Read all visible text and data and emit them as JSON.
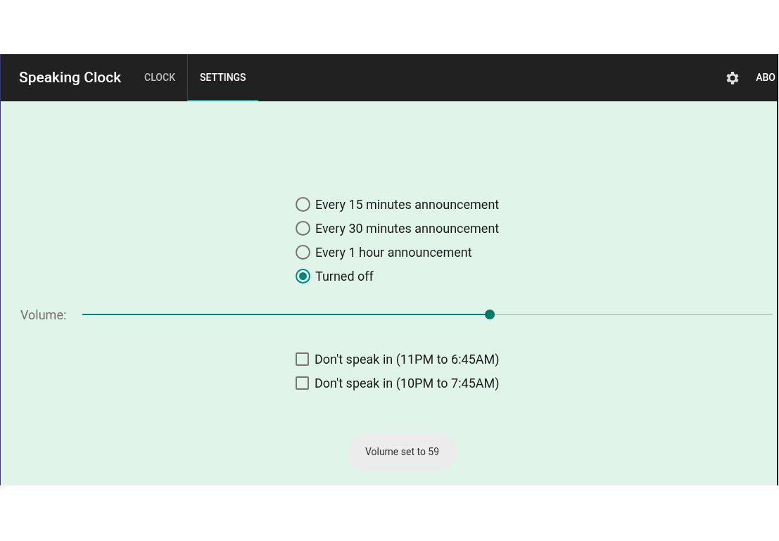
{
  "app_bar": {
    "title": "Speaking Clock",
    "tabs": [
      {
        "label": "CLOCK",
        "selected": false
      },
      {
        "label": "SETTINGS",
        "selected": true
      }
    ],
    "about_label": "ABO"
  },
  "announcements": [
    {
      "label": "Every 15 minutes announcement",
      "selected": false
    },
    {
      "label": "Every 30 minutes announcement",
      "selected": false
    },
    {
      "label": "Every 1 hour announcement",
      "selected": false
    },
    {
      "label": "Turned off",
      "selected": true
    }
  ],
  "volume": {
    "label": "Volume:",
    "level": 0.59
  },
  "quiet_hours": [
    {
      "label": "Don't speak in (11PM to 6:45AM)",
      "checked": false
    },
    {
      "label": "Don't speak in (10PM to 7:45AM)",
      "checked": false
    }
  ],
  "toast": "Volume set to 59"
}
